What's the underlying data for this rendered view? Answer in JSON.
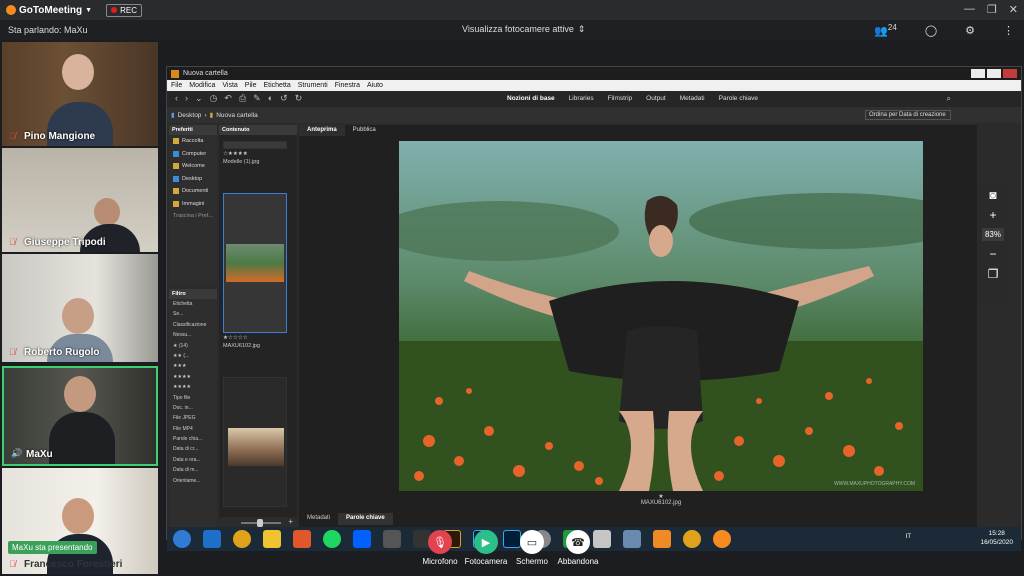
{
  "meeting": {
    "app_name": "GoToMeeting",
    "rec_label": "REC",
    "speaking_label": "Sta parlando: MaXu",
    "camera_view_label": "Visualizza fotocamere attive",
    "attendee_count": "24",
    "presenting_label": "MaXu sta presentando",
    "participants": [
      {
        "name": "Pino Mangione",
        "muted": true
      },
      {
        "name": "Giuseppe Tripodi",
        "muted": true
      },
      {
        "name": "Roberto Rugolo",
        "muted": true
      },
      {
        "name": "MaXu",
        "muted": false
      },
      {
        "name": "Francesco Forestieri",
        "muted": true
      }
    ],
    "toolbar": [
      {
        "label": "Microfono",
        "icon": "mic-off-icon",
        "color": "#e2434f"
      },
      {
        "label": "Fotocamera",
        "icon": "camera-icon",
        "color": "#2bbf8a"
      },
      {
        "label": "Schermo",
        "icon": "screen-share-icon",
        "color": "#ffffff"
      },
      {
        "label": "Abbandona",
        "icon": "hang-up-icon",
        "color": "#ffffff"
      }
    ]
  },
  "bridge": {
    "window_title": "Nuova cartella",
    "menu": [
      "File",
      "Modifica",
      "Vista",
      "Pile",
      "Etichetta",
      "Strumenti",
      "Finestra",
      "Aiuto"
    ],
    "modes": [
      "Nozioni di base",
      "Libraries",
      "Filmstrip",
      "Output",
      "Metadati",
      "Parole chiave"
    ],
    "breadcrumb": [
      "Desktop",
      "Nuova cartella"
    ],
    "sort_label": "Ordina per Data di creazione",
    "favorites_header": "Preferiti",
    "favorites": [
      "Raccolta",
      "Computer",
      "Welcome",
      "Desktop",
      "Documenti",
      "Immagini",
      "Trascina i Pref..."
    ],
    "content_header": "Contenuto",
    "filter_header": "Filtro",
    "filter_items": [
      "Etichetta",
      "Se...",
      "Classificazione",
      "Nessu...",
      "★ (14)",
      "★★ (...",
      "★★★",
      "★★★★",
      "★★★★",
      "Tipo file",
      "Doc. in...",
      "File JPEG",
      "File MP4",
      "Parole chia...",
      "Data di cr...",
      "Data e ora...",
      "Data di m...",
      "Orientame..."
    ],
    "thumbnails": [
      {
        "stars": "☆★★★★",
        "name": "Modelle (1).jpg"
      },
      {
        "stars": "★☆☆☆☆",
        "name": "MAXU6102.jpg"
      },
      {
        "stars": "",
        "name": ""
      }
    ],
    "preview_tabs": [
      "Anteprima",
      "Pubblica"
    ],
    "preview_caption_star": "★",
    "preview_caption": "MAXU6102.jpg",
    "photo_watermark": "WWW.MAXUPHOTOGRAPHY.COM",
    "zoom": "83%",
    "bottom_tabs": [
      "Metadati",
      "Parole chiave"
    ],
    "taskbar_time": "15:28",
    "taskbar_date": "16/05/2020",
    "taskbar_lang": "IT"
  }
}
